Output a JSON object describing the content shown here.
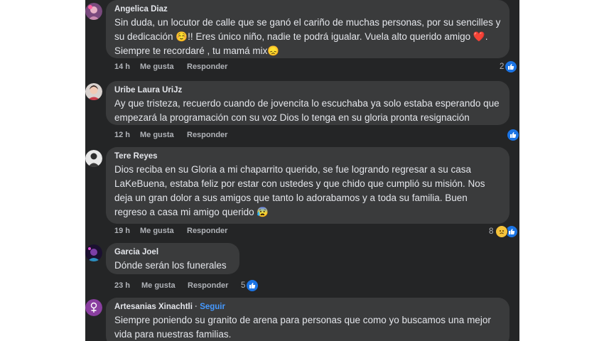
{
  "colors": {
    "background": "#242526",
    "bubble": "#3a3b3c",
    "text": "#e4e6eb",
    "meta": "#b0b3b8",
    "like_blue": "#1b74e4",
    "follow_blue": "#4599ff"
  },
  "comments": [
    {
      "author": "Angelica Diaz",
      "text": "Sin duda, un locutor de calle que se ganó el cariño de muchas personas, por su sencilles y su dedicación ☺️!! Eres único niño, nadie te podrá igualar. Vuela alto querido amigo ❤️. Siempre te recordaré , tu mamá mix😞",
      "time": "14 h",
      "like": "Me gusta",
      "reply": "Responder",
      "reaction_count": "2",
      "reactions": [
        "like-icon"
      ]
    },
    {
      "author": "Uribe Laura UriJz",
      "text": "Ay que tristeza, recuerdo cuando de jovencita lo escuchaba ya solo estaba esperando que empezará la programación con su voz Dios lo tenga en su gloria pronta resignación",
      "time": "12 h",
      "like": "Me gusta",
      "reply": "Responder",
      "reaction_count": "",
      "reactions": [
        "like-icon"
      ]
    },
    {
      "author": "Tere Reyes",
      "text": "Dios reciba en su Gloria a mi chaparrito querido, se fue logrando regresar a su casa LaKeBuena, estaba feliz por estar con ustedes y que chido que cumplió su misión. Nos deja un gran dolor a sus amigos que tanto lo adorabamos y a toda su familia. Buen regreso a casa mi amigo querido 😰",
      "time": "19 h",
      "like": "Me gusta",
      "reply": "Responder",
      "reaction_count": "8",
      "reactions": [
        "sad-icon",
        "like-icon"
      ]
    },
    {
      "author": "Garcia Joel",
      "text": "Dónde serán los funerales",
      "time": "23 h",
      "like": "Me gusta",
      "reply": "Responder",
      "reaction_count": "5",
      "reactions": [
        "like-icon"
      ]
    },
    {
      "author": "Artesanias Xinachtli",
      "follow_separator": "·",
      "follow": "Seguir",
      "text": "Siempre poniendo su granito de arena para personas que como yo buscamos una mejor vida para nuestras familias."
    }
  ]
}
